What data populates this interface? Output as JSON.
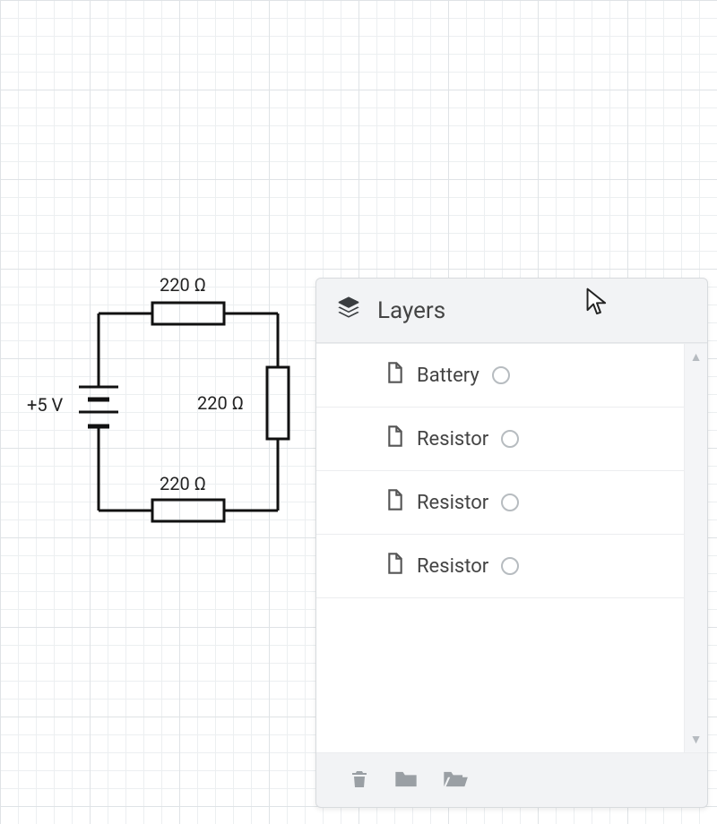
{
  "circuit": {
    "voltage_label": "+5 V",
    "r_top_label": "220 Ω",
    "r_right_label": "220 Ω",
    "r_bottom_label": "220 Ω"
  },
  "panel": {
    "title": "Layers",
    "items": [
      {
        "name": "Battery"
      },
      {
        "name": "Resistor"
      },
      {
        "name": "Resistor"
      },
      {
        "name": "Resistor"
      }
    ]
  }
}
